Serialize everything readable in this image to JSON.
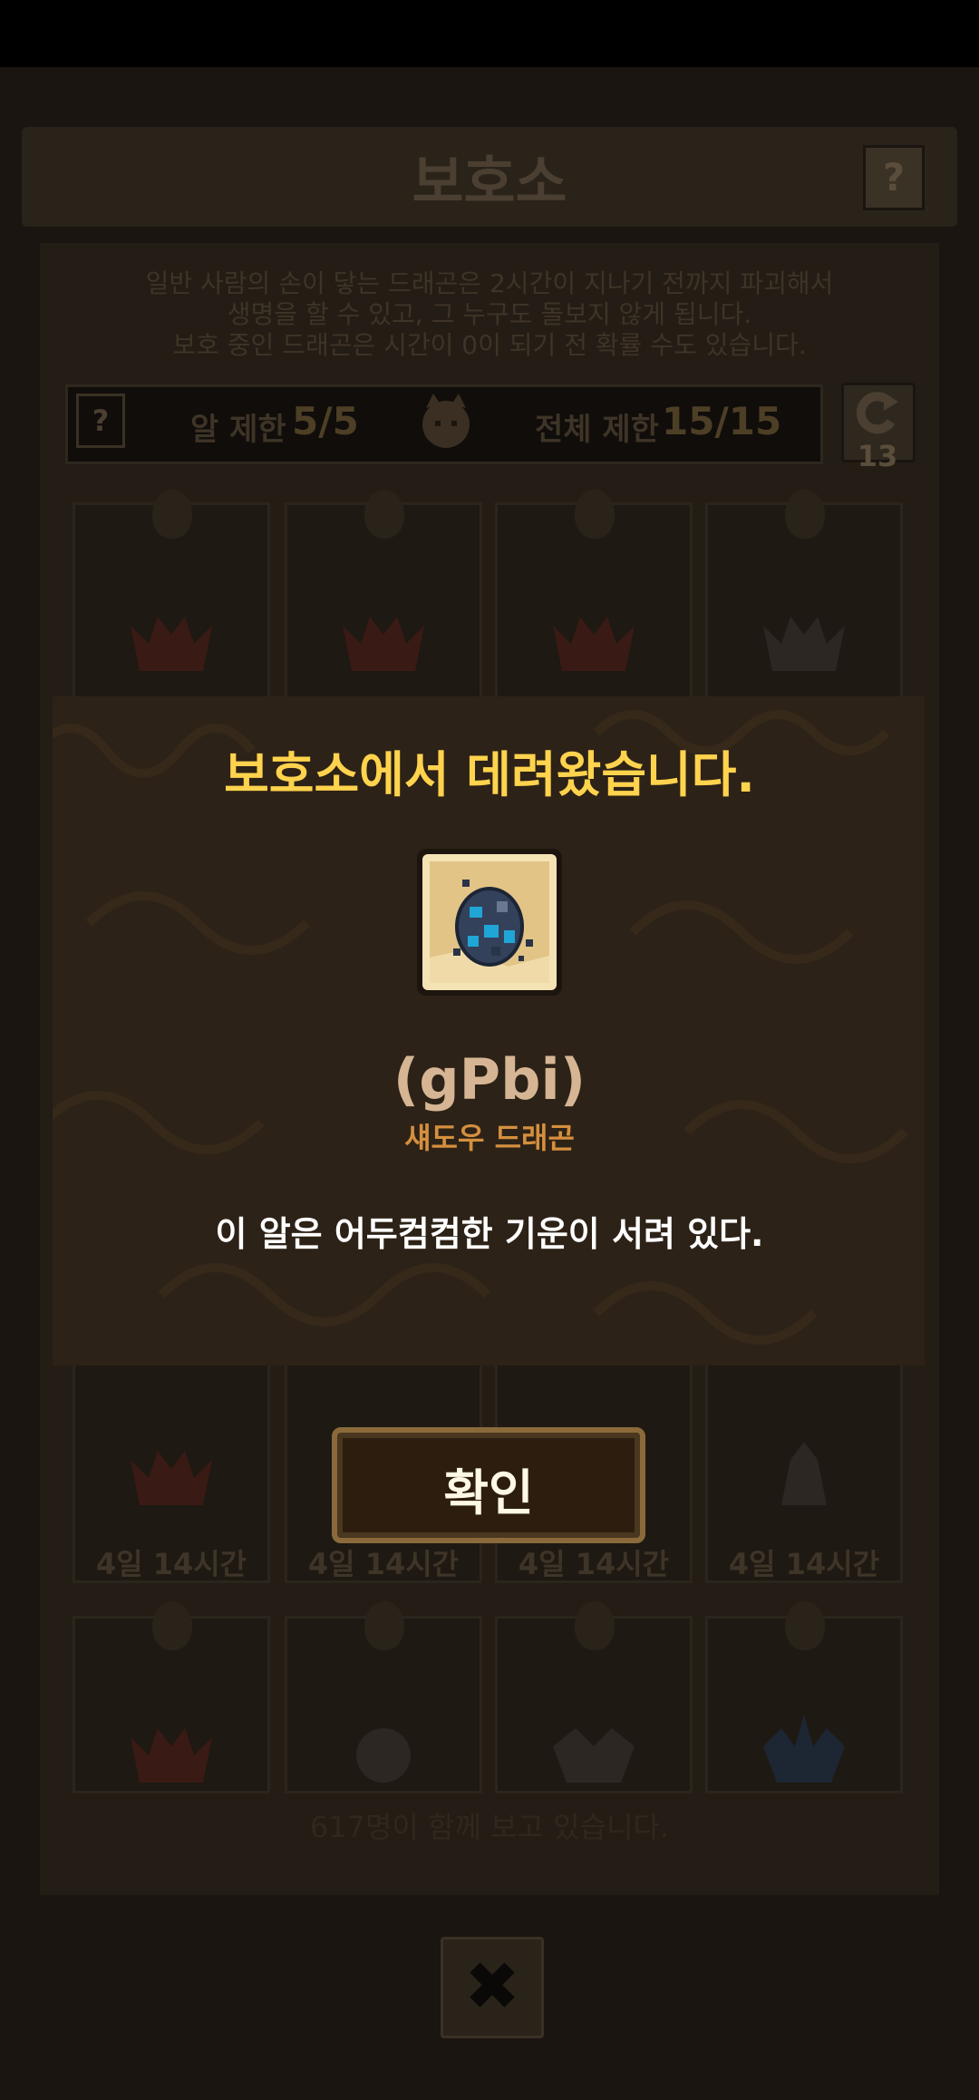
{
  "background": {
    "title": "보호소",
    "help_label": "?",
    "description_lines": [
      "일반 사람의 손이 닿는 드래곤은 2시간이 지나기 전까지 파괴해서",
      "생명을 할 수 있고, 그 누구도 돌보지 않게 됩니다.",
      "보호 중인 드래곤은 시간이 0이 되기 전 확률 수도 있습니다."
    ],
    "limits": {
      "help_label": "?",
      "egg_limit_label": "알 제한",
      "egg_limit_value": "5/5",
      "total_limit_label": "전체 제한",
      "total_limit_value": "15/15"
    },
    "refresh_count": "13",
    "card_rows": [
      {
        "times": [
          "",
          "",
          "",
          ""
        ]
      },
      {
        "times": [
          "4일 14시간",
          "4일 14시간",
          "4일 14시간",
          "4일 14시간"
        ]
      },
      {
        "times": [
          "",
          "",
          "",
          ""
        ]
      }
    ],
    "footer_note": "617명이 함께 보고 있습니다.",
    "close_icon": "close-icon",
    "close_glyph": "✖"
  },
  "modal": {
    "title": "보호소에서 데려왔습니다.",
    "egg_icon": "shadow-dragon-egg-icon",
    "egg_code": "(gPbi)",
    "species": "섀도우 드래곤",
    "description": "이 알은 어두컴컴한 기운이 서려 있다.",
    "confirm_label": "확인"
  },
  "colors": {
    "title_yellow": "#ffd34d",
    "species_orange": "#d48f3e",
    "modal_bg": "#2d2217",
    "egg_blue": "#1fa6d6"
  }
}
